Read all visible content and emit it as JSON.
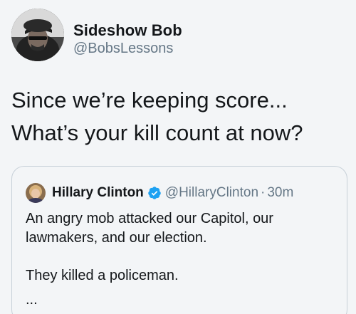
{
  "tweet": {
    "author": {
      "name": "Sideshow Bob",
      "handle": "@BobsLessons",
      "avatar_icon": "profile-photo-avatar"
    },
    "text": "Since we’re keeping score... What’s your kill count at now?"
  },
  "quoted_tweet": {
    "author": {
      "name": "Hillary Clinton",
      "handle": "@HillaryClinton",
      "verified": true,
      "avatar_icon": "profile-photo-avatar"
    },
    "separator": "·",
    "time": "30m",
    "text_paragraph_1": "An angry mob attacked our Capitol, our lawmakers, and our election.",
    "text_paragraph_2": "They killed a policeman.",
    "truncation": "..."
  },
  "colors": {
    "background": "#f3f5f7",
    "text_primary": "#14171a",
    "text_secondary": "#657786",
    "verified_badge": "#1da1f2",
    "card_border": "#c7d0d8"
  }
}
